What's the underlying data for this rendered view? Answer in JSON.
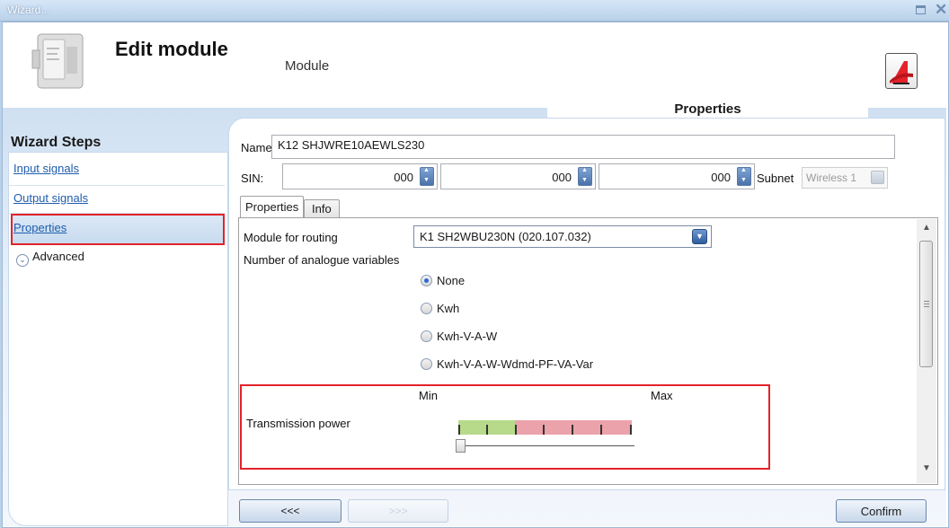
{
  "window": {
    "title": "Wizard..."
  },
  "header": {
    "title": "Edit module",
    "subtitle": "Module",
    "section_tab": "Properties"
  },
  "sidebar": {
    "title": "Wizard Steps",
    "items": [
      {
        "label": "Input signals"
      },
      {
        "label": "Output signals"
      },
      {
        "label": "Properties",
        "selected": true
      }
    ],
    "advanced_label": "Advanced"
  },
  "form": {
    "name_label": "Name",
    "name_value": "K12 SHJWRE10AEWLS230",
    "sin_label": "SIN:",
    "sin_values": [
      "000",
      "000",
      "000"
    ],
    "subnet_label": "Subnet",
    "subnet_value": "Wireless 1"
  },
  "tabs": [
    {
      "label": "Properties",
      "active": true
    },
    {
      "label": "Info",
      "active": false
    }
  ],
  "properties": {
    "routing_label": "Module for routing",
    "routing_value": "K1 SH2WBU230N (020.107.032)",
    "analogue_label": "Number of analogue variables",
    "analogue_options": [
      "None",
      "Kwh",
      "Kwh-V-A-W",
      "Kwh-V-A-W-Wdmd-PF-VA-Var"
    ],
    "analogue_selected": "None",
    "power_label": "Transmission power",
    "min_label": "Min",
    "max_label": "Max",
    "power_level": 0
  },
  "buttons": {
    "prev": "<<<",
    "next": ">>>",
    "confirm": "Confirm"
  },
  "colors": {
    "highlight": "#e3222a",
    "link": "#1f5cae",
    "accent": "#4a73ab"
  }
}
